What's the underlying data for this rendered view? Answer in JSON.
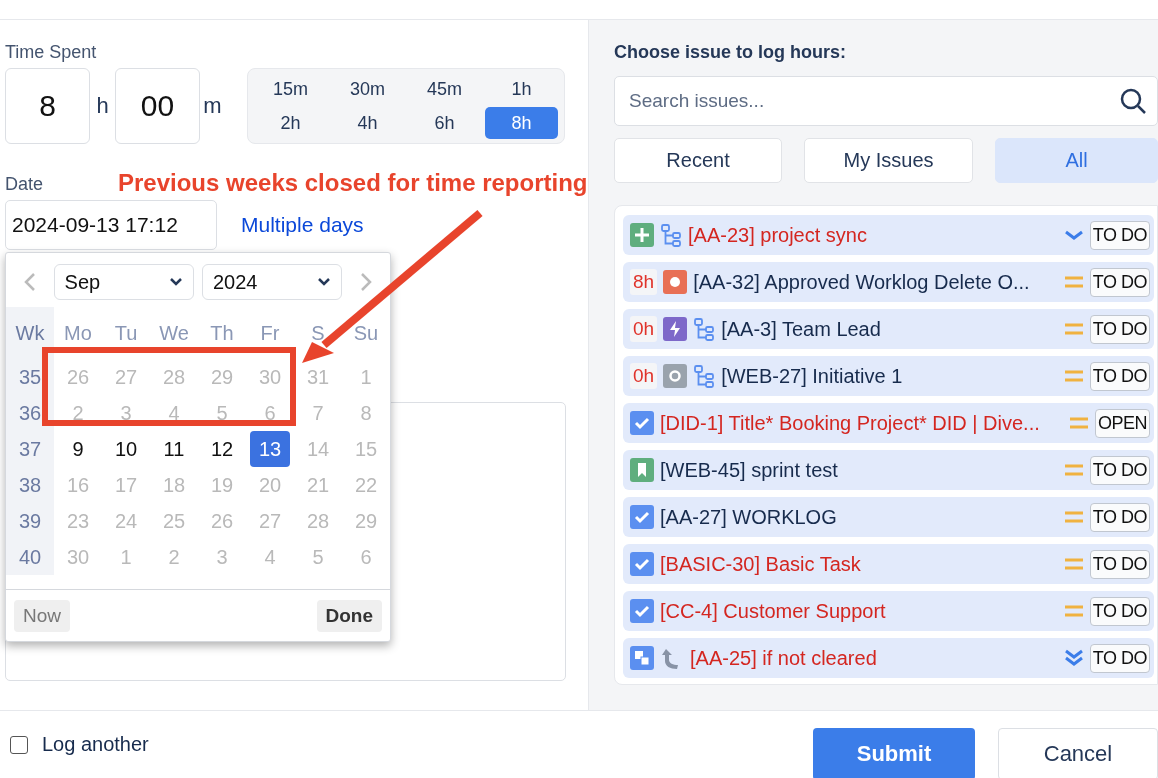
{
  "time_spent": {
    "label": "Time Spent",
    "hours": "8",
    "hours_unit": "h",
    "minutes": "00",
    "minutes_unit": "m",
    "presets": [
      {
        "label": "15m",
        "selected": false
      },
      {
        "label": "30m",
        "selected": false
      },
      {
        "label": "45m",
        "selected": false
      },
      {
        "label": "1h",
        "selected": false
      },
      {
        "label": "2h",
        "selected": false
      },
      {
        "label": "4h",
        "selected": false
      },
      {
        "label": "6h",
        "selected": false
      },
      {
        "label": "8h",
        "selected": true
      }
    ]
  },
  "date": {
    "label": "Date",
    "value": "2024-09-13 17:12",
    "multiple_days_link": "Multiple days"
  },
  "calendar": {
    "month": "Sep",
    "year": "2024",
    "week_header": "Wk",
    "weekdays": [
      "Mo",
      "Tu",
      "We",
      "Th",
      "Fr",
      "S",
      "Su"
    ],
    "weeks": [
      {
        "number": "35",
        "days": [
          {
            "day": "26",
            "disabled": true,
            "selected": false
          },
          {
            "day": "27",
            "disabled": true,
            "selected": false
          },
          {
            "day": "28",
            "disabled": true,
            "selected": false
          },
          {
            "day": "29",
            "disabled": true,
            "selected": false
          },
          {
            "day": "30",
            "disabled": true,
            "selected": false
          },
          {
            "day": "31",
            "disabled": true,
            "selected": false
          },
          {
            "day": "1",
            "disabled": true,
            "selected": false
          }
        ]
      },
      {
        "number": "36",
        "days": [
          {
            "day": "2",
            "disabled": true,
            "selected": false
          },
          {
            "day": "3",
            "disabled": true,
            "selected": false
          },
          {
            "day": "4",
            "disabled": true,
            "selected": false
          },
          {
            "day": "5",
            "disabled": true,
            "selected": false
          },
          {
            "day": "6",
            "disabled": true,
            "selected": false
          },
          {
            "day": "7",
            "disabled": true,
            "selected": false
          },
          {
            "day": "8",
            "disabled": true,
            "selected": false
          }
        ]
      },
      {
        "number": "37",
        "days": [
          {
            "day": "9",
            "disabled": false,
            "selected": false
          },
          {
            "day": "10",
            "disabled": false,
            "selected": false
          },
          {
            "day": "11",
            "disabled": false,
            "selected": false
          },
          {
            "day": "12",
            "disabled": false,
            "selected": false
          },
          {
            "day": "13",
            "disabled": false,
            "selected": true
          },
          {
            "day": "14",
            "disabled": true,
            "selected": false
          },
          {
            "day": "15",
            "disabled": true,
            "selected": false
          }
        ]
      },
      {
        "number": "38",
        "days": [
          {
            "day": "16",
            "disabled": true,
            "selected": false
          },
          {
            "day": "17",
            "disabled": true,
            "selected": false
          },
          {
            "day": "18",
            "disabled": true,
            "selected": false
          },
          {
            "day": "19",
            "disabled": true,
            "selected": false
          },
          {
            "day": "20",
            "disabled": true,
            "selected": false
          },
          {
            "day": "21",
            "disabled": true,
            "selected": false
          },
          {
            "day": "22",
            "disabled": true,
            "selected": false
          }
        ]
      },
      {
        "number": "39",
        "days": [
          {
            "day": "23",
            "disabled": true,
            "selected": false
          },
          {
            "day": "24",
            "disabled": true,
            "selected": false
          },
          {
            "day": "25",
            "disabled": true,
            "selected": false
          },
          {
            "day": "26",
            "disabled": true,
            "selected": false
          },
          {
            "day": "27",
            "disabled": true,
            "selected": false
          },
          {
            "day": "28",
            "disabled": true,
            "selected": false
          },
          {
            "day": "29",
            "disabled": true,
            "selected": false
          }
        ]
      },
      {
        "number": "40",
        "days": [
          {
            "day": "30",
            "disabled": true,
            "selected": false
          },
          {
            "day": "1",
            "disabled": true,
            "selected": false
          },
          {
            "day": "2",
            "disabled": true,
            "selected": false
          },
          {
            "day": "3",
            "disabled": true,
            "selected": false
          },
          {
            "day": "4",
            "disabled": true,
            "selected": false
          },
          {
            "day": "5",
            "disabled": true,
            "selected": false
          },
          {
            "day": "6",
            "disabled": true,
            "selected": false
          }
        ]
      }
    ],
    "now_button": "Now",
    "done_button": "Done"
  },
  "annotation": {
    "text": "Previous weeks closed for time reporting"
  },
  "issues_panel": {
    "heading": "Choose issue to log hours:",
    "search": {
      "placeholder": "Search issues..."
    },
    "tabs": [
      {
        "label": "Recent",
        "selected": false
      },
      {
        "label": "My Issues",
        "selected": false
      },
      {
        "label": "All",
        "selected": true
      }
    ],
    "issues": [
      {
        "kind": "new",
        "hierarchy": true,
        "title": "[AA-23] project sync",
        "flagged": true,
        "priority": {
          "kind": "low"
        },
        "status": "TO DO"
      },
      {
        "hours": "8h",
        "kind": "bug",
        "title": "[AA-32] Approved Worklog Delete O...",
        "flagged": false,
        "priority": {
          "kind": "medium"
        },
        "status": "TO DO"
      },
      {
        "hours": "0h",
        "kind": "epic",
        "hierarchy": true,
        "title": "[AA-3] Team Lead",
        "flagged": false,
        "priority": {
          "kind": "medium"
        },
        "status": "TO DO"
      },
      {
        "hours": "0h",
        "kind": "initiative",
        "hierarchy": true,
        "title": "[WEB-27] Initiative 1",
        "flagged": false,
        "priority": {
          "kind": "medium"
        },
        "status": "TO DO"
      },
      {
        "kind": "task",
        "title": "[DID-1] Title* Booking Project* DID | Dive...",
        "flagged": true,
        "priority": {
          "kind": "medium"
        },
        "status": "OPEN"
      },
      {
        "kind": "story",
        "title": "[WEB-45] sprint test",
        "flagged": false,
        "priority": {
          "kind": "medium"
        },
        "status": "TO DO"
      },
      {
        "kind": "task",
        "title": "[AA-27] WORKLOG",
        "flagged": false,
        "priority": {
          "kind": "medium"
        },
        "status": "TO DO"
      },
      {
        "kind": "task",
        "title": "[BASIC-30] Basic Task",
        "flagged": true,
        "priority": {
          "kind": "medium"
        },
        "status": "TO DO"
      },
      {
        "kind": "task",
        "title": "[CC-4] Customer Support",
        "flagged": true,
        "priority": {
          "kind": "medium"
        },
        "status": "TO DO"
      },
      {
        "kind": "subtask",
        "parent_link": true,
        "title": "[AA-25] if not cleared",
        "flagged": true,
        "priority": {
          "kind": "lowest"
        },
        "status": "TO DO"
      }
    ]
  },
  "footer": {
    "log_another": {
      "label": "Log another",
      "checked": false
    },
    "submit": "Submit",
    "cancel": "Cancel"
  }
}
